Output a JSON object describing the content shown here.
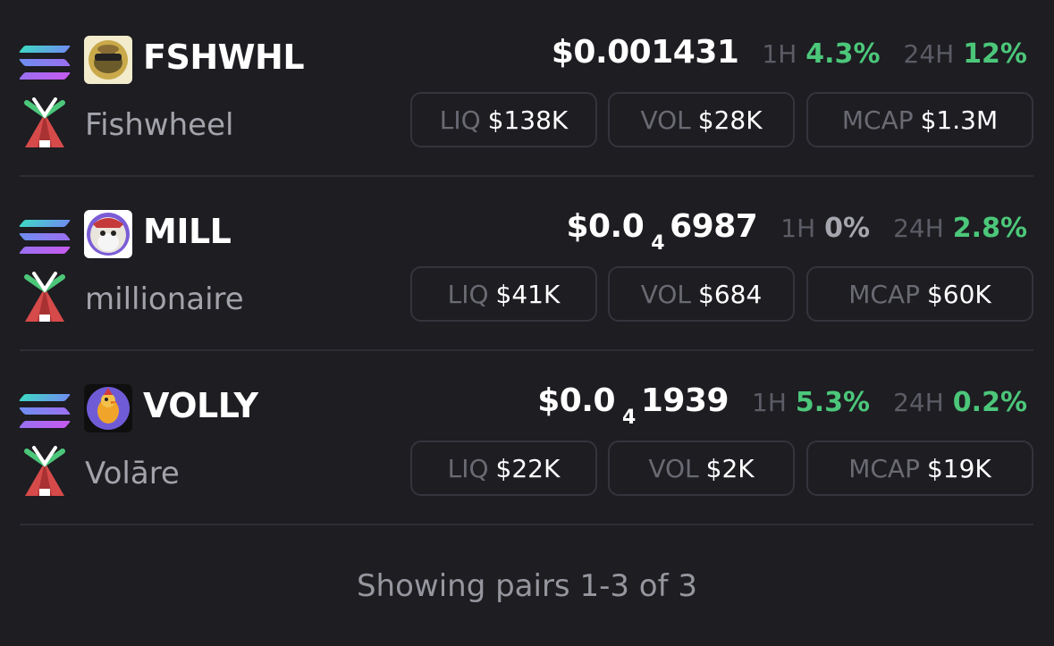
{
  "pairs": [
    {
      "symbol": "FSHWHL",
      "name": "Fishwheel",
      "price_main": "$0.001431",
      "price_zeros": "",
      "price_tail": "",
      "h1_label": "1H",
      "h1_value": "4.3%",
      "h24_label": "24H",
      "h24_value": "12%",
      "liq_label": "LIQ",
      "liq_value": "$138K",
      "vol_label": "VOL",
      "vol_value": "$28K",
      "mcap_label": "MCAP",
      "mcap_value": "$1.3M",
      "chain_icon": "solana-icon",
      "dex_icon": "dex-tent-icon",
      "avatar_icon": "fishwheel-avatar-icon"
    },
    {
      "symbol": "MILL",
      "name": "millionaire",
      "price_main": "$0.0",
      "price_zeros": "4",
      "price_tail": "6987",
      "h1_label": "1H",
      "h1_value": "0%",
      "h24_label": "24H",
      "h24_value": "2.8%",
      "liq_label": "LIQ",
      "liq_value": "$41K",
      "vol_label": "VOL",
      "vol_value": "$684",
      "mcap_label": "MCAP",
      "mcap_value": "$60K",
      "chain_icon": "solana-icon",
      "dex_icon": "dex-tent-icon",
      "avatar_icon": "millionaire-avatar-icon"
    },
    {
      "symbol": "VOLLY",
      "name": "Volāre",
      "price_main": "$0.0",
      "price_zeros": "4",
      "price_tail": "1939",
      "h1_label": "1H",
      "h1_value": "5.3%",
      "h24_label": "24H",
      "h24_value": "0.2%",
      "liq_label": "LIQ",
      "liq_value": "$22K",
      "vol_label": "VOL",
      "vol_value": "$2K",
      "mcap_label": "MCAP",
      "mcap_value": "$19K",
      "chain_icon": "solana-icon",
      "dex_icon": "dex-tent-icon",
      "avatar_icon": "volly-avatar-icon"
    }
  ],
  "footer": {
    "text": "Showing pairs 1-3 of 3"
  },
  "colors": {
    "background": "#1d1d22",
    "positive": "#4cc77a",
    "neutral": "#a6a6ae",
    "muted_label": "#5c5c66",
    "border": "#34343c"
  }
}
